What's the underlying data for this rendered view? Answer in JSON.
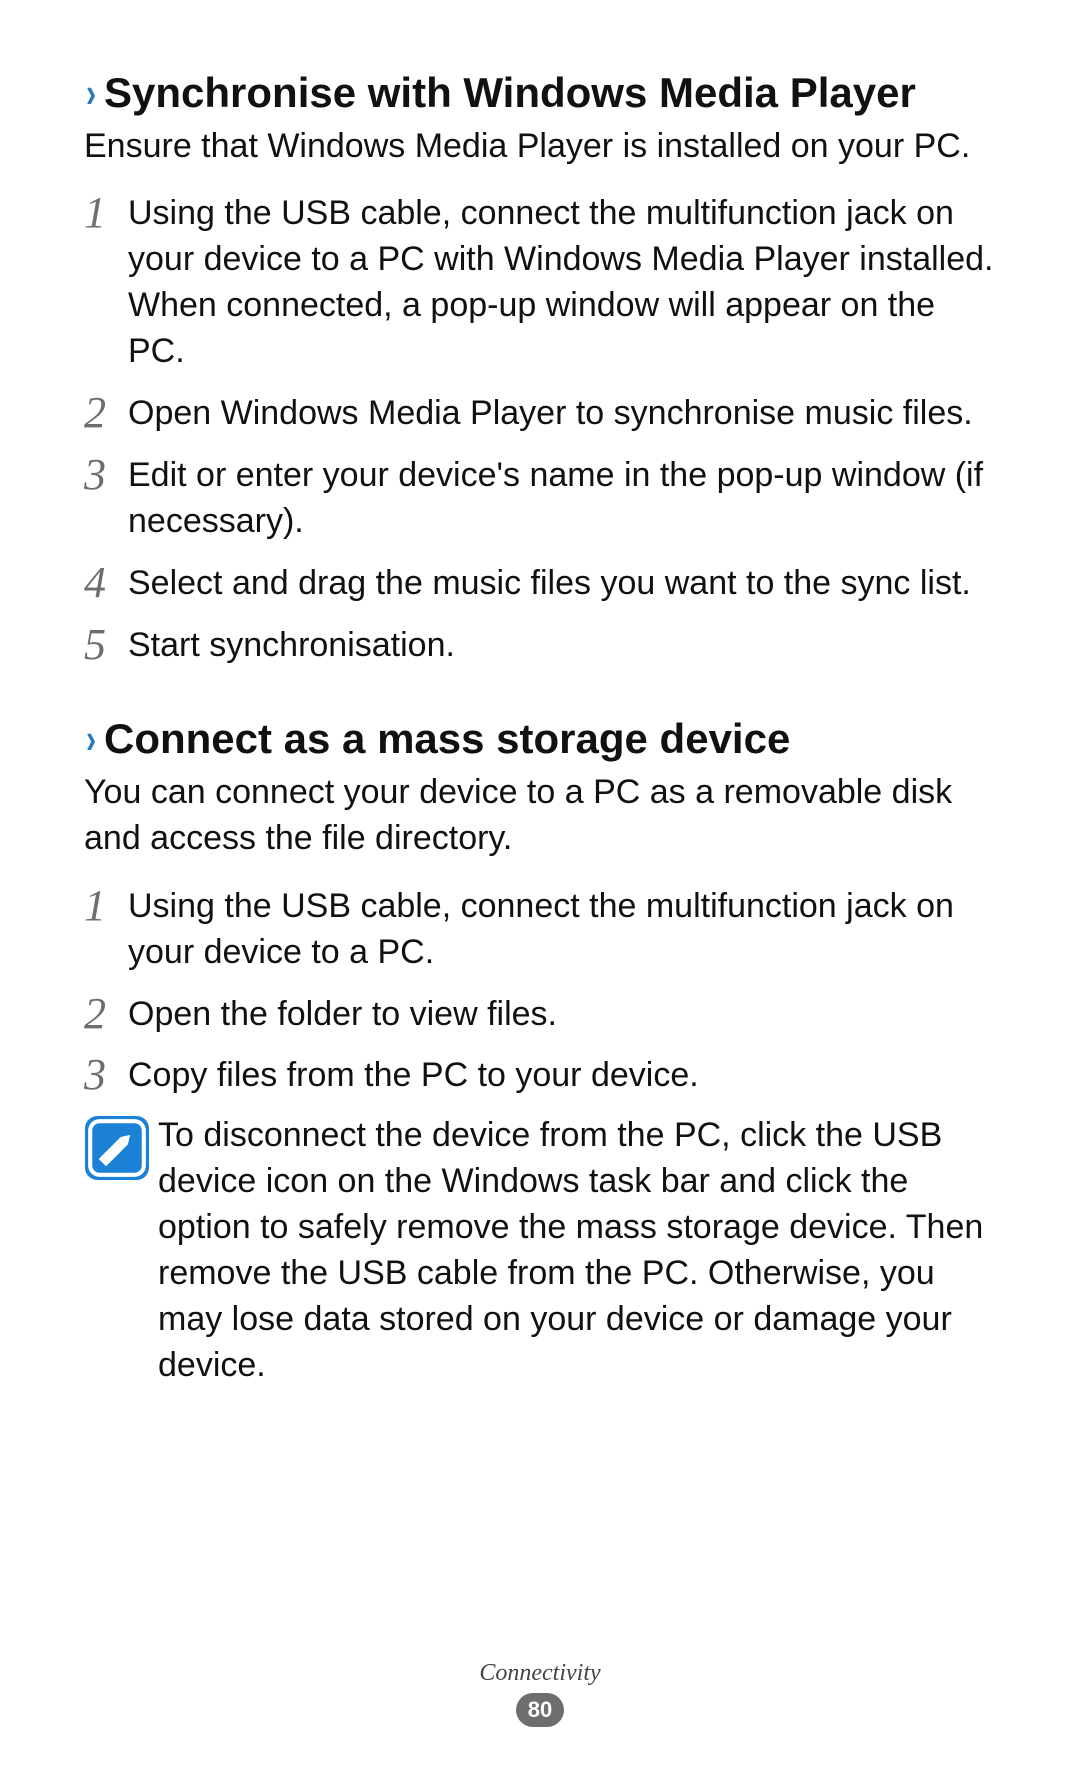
{
  "section1": {
    "heading": "Synchronise with Windows Media Player",
    "intro": "Ensure that Windows Media Player is installed on your PC.",
    "steps": [
      "Using the USB cable, connect the multifunction jack on your device to a PC with Windows Media Player installed. When connected, a pop-up window will appear on the PC.",
      "Open Windows Media Player to synchronise music files.",
      "Edit or enter your device's name in the pop-up window (if necessary).",
      "Select and drag the music files you want to the sync list.",
      "Start synchronisation."
    ]
  },
  "section2": {
    "heading": "Connect as a mass storage device",
    "intro": "You can connect your device to a PC as a removable disk and access the file directory.",
    "steps": [
      "Using the USB cable, connect the multifunction jack on your device to a PC.",
      "Open the folder to view files.",
      "Copy files from the PC to your device."
    ],
    "note": "To disconnect the device from the PC, click the USB device icon on the Windows task bar and click the option to safely remove the mass storage device. Then remove the USB cable from the PC. Otherwise, you may lose data stored on your device or damage your device."
  },
  "footer": {
    "category": "Connectivity",
    "page": "80"
  },
  "glyphs": {
    "chevron": "›"
  }
}
